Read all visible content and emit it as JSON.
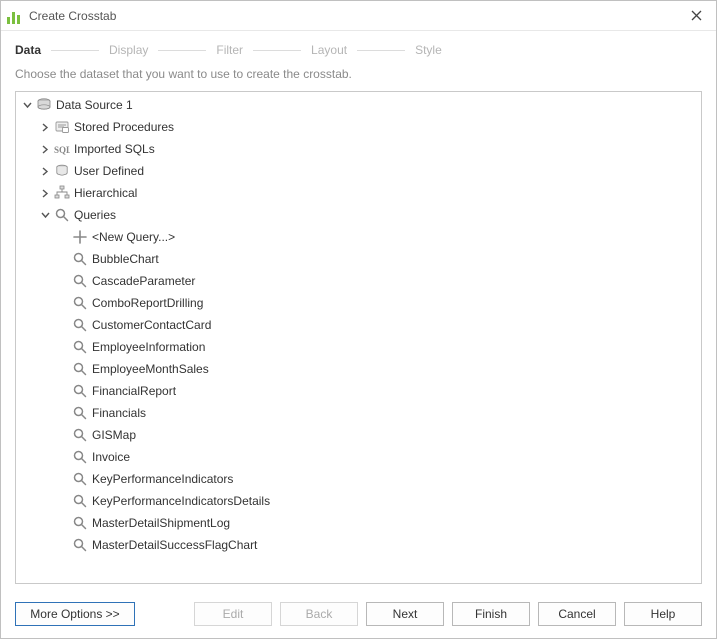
{
  "window": {
    "title": "Create Crosstab"
  },
  "steps": [
    {
      "label": "Data",
      "active": true
    },
    {
      "label": "Display",
      "active": false
    },
    {
      "label": "Filter",
      "active": false
    },
    {
      "label": "Layout",
      "active": false
    },
    {
      "label": "Style",
      "active": false
    }
  ],
  "instruction": "Choose the dataset that you want to use to create the crosstab.",
  "tree": {
    "root": {
      "label": "Data Source 1",
      "icon": "database",
      "expanded": true,
      "children": [
        {
          "label": "Stored Procedures",
          "icon": "storedproc",
          "expanded": false,
          "hasChildren": true
        },
        {
          "label": "Imported SQLs",
          "icon": "sql",
          "expanded": false,
          "hasChildren": true
        },
        {
          "label": "User Defined",
          "icon": "userdef",
          "expanded": false,
          "hasChildren": true
        },
        {
          "label": "Hierarchical",
          "icon": "hierarchy",
          "expanded": false,
          "hasChildren": true
        },
        {
          "label": "Queries",
          "icon": "query",
          "expanded": true,
          "hasChildren": true,
          "children": [
            {
              "label": "<New Query...>",
              "icon": "plus"
            },
            {
              "label": "BubbleChart",
              "icon": "query"
            },
            {
              "label": "CascadeParameter",
              "icon": "query"
            },
            {
              "label": "ComboReportDrilling",
              "icon": "query"
            },
            {
              "label": "CustomerContactCard",
              "icon": "query"
            },
            {
              "label": "EmployeeInformation",
              "icon": "query"
            },
            {
              "label": "EmployeeMonthSales",
              "icon": "query"
            },
            {
              "label": "FinancialReport",
              "icon": "query"
            },
            {
              "label": "Financials",
              "icon": "query"
            },
            {
              "label": "GISMap",
              "icon": "query"
            },
            {
              "label": "Invoice",
              "icon": "query"
            },
            {
              "label": "KeyPerformanceIndicators",
              "icon": "query"
            },
            {
              "label": "KeyPerformanceIndicatorsDetails",
              "icon": "query"
            },
            {
              "label": "MasterDetailShipmentLog",
              "icon": "query"
            },
            {
              "label": "MasterDetailSuccessFlagChart",
              "icon": "query"
            }
          ]
        }
      ]
    }
  },
  "buttons": {
    "more": "More Options >>",
    "edit": "Edit",
    "back": "Back",
    "next": "Next",
    "finish": "Finish",
    "cancel": "Cancel",
    "help": "Help"
  }
}
